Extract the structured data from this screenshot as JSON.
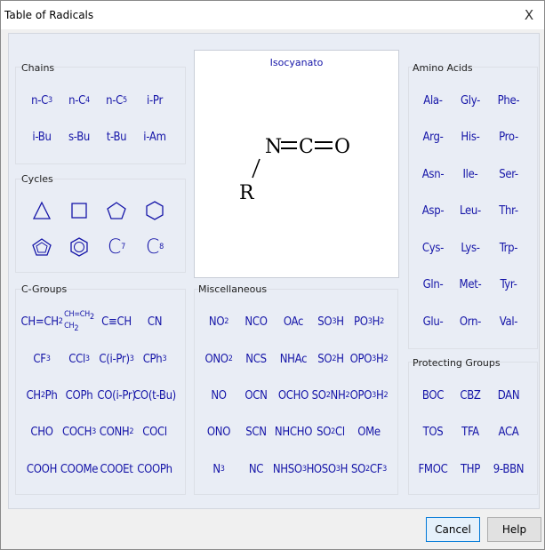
{
  "window": {
    "title": "Table of Radicals",
    "close_glyph": "X"
  },
  "groups": {
    "chains": {
      "title": "Chains",
      "items": [
        "n-C3",
        "n-C4",
        "n-C5",
        "i-Pr",
        "i-Bu",
        "s-Bu",
        "t-Bu",
        "i-Am"
      ]
    },
    "cycles": {
      "title": "Cycles",
      "items": [
        "triangle",
        "square",
        "pentagon",
        "hexagon",
        "cyclopentadienyl",
        "phenyl",
        "C7",
        "C8"
      ],
      "labels": {
        "c7": "C",
        "c7_sub": "7",
        "c8": "C",
        "c8_sub": "8"
      }
    },
    "c_groups": {
      "title": "C-Groups",
      "items": [
        "CH=CH2",
        "CH=CH2 / CH2",
        "C≡CH",
        "CN",
        "CF3",
        "CCl3",
        "C(i-Pr)3",
        "CPh3",
        "CH2Ph",
        "COPh",
        "CO(i-Pr)",
        "CO(t-Bu)",
        "CHO",
        "COCH3",
        "CONH2",
        "COCl",
        "COOH",
        "COOMe",
        "COOEt",
        "COOPh"
      ]
    },
    "misc": {
      "title": "Miscellaneous",
      "items": [
        "NO2",
        "NCO",
        "OAc",
        "SO3H",
        "PO3H2",
        "ONO2",
        "NCS",
        "NHAc",
        "SO2H",
        "OPO3H2",
        "NO",
        "OCN",
        "OCHO",
        "SO2NH2",
        "OPO3H2",
        "ONO",
        "SCN",
        "NHCHO",
        "SO2Cl",
        "OMe",
        "N3",
        "NC",
        "NHSO3H",
        "OSO3H",
        "SO2CF3"
      ]
    },
    "amino_acids": {
      "title": "Amino Acids",
      "items": [
        "Ala-",
        "Gly-",
        "Phe-",
        "Arg-",
        "His-",
        "Pro-",
        "Asn-",
        "Ile-",
        "Ser-",
        "Asp-",
        "Leu-",
        "Thr-",
        "Cys-",
        "Lys-",
        "Trp-",
        "Gln-",
        "Met-",
        "Tyr-",
        "Glu-",
        "Orn-",
        "Val-"
      ]
    },
    "protecting": {
      "title": "Protecting Groups",
      "items": [
        "BOC",
        "CBZ",
        "DAN",
        "TOS",
        "TFA",
        "ACA",
        "FMOC",
        "THP",
        "9-BBN"
      ]
    }
  },
  "preview": {
    "name": "Isocyanato",
    "structure": {
      "n": "N",
      "c": "C",
      "o": "O",
      "r": "R"
    }
  },
  "buttons": {
    "cancel": "Cancel",
    "help": "Help"
  }
}
